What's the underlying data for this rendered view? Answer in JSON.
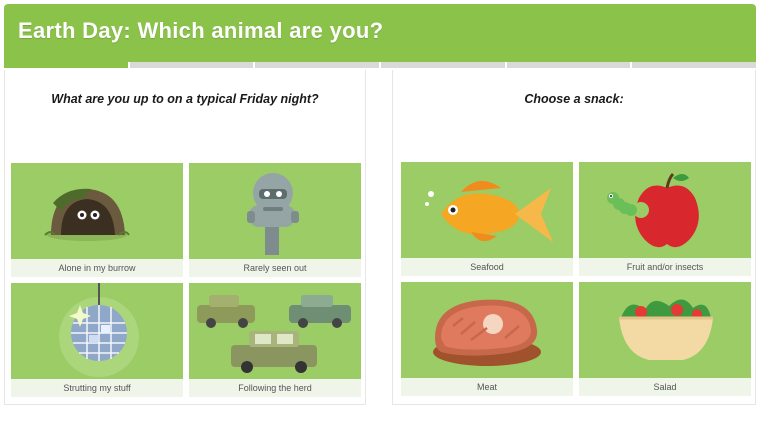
{
  "header": {
    "title": "Earth Day: Which animal are you?"
  },
  "progress": {
    "segments": 6,
    "completed": 1,
    "color_active": "#8bc34a",
    "color_inactive": "#d9d9d9"
  },
  "questions": [
    {
      "text": "What are you up to on a typical Friday night?",
      "answers": [
        {
          "label": "Alone in my burrow",
          "icon": "burrow-icon"
        },
        {
          "label": "Rarely seen out",
          "icon": "binoculars-viewer-icon"
        },
        {
          "label": "Strutting my stuff",
          "icon": "disco-ball-icon"
        },
        {
          "label": "Following the herd",
          "icon": "cars-icon"
        }
      ]
    },
    {
      "text": "Choose a snack:",
      "answers": [
        {
          "label": "Seafood",
          "icon": "goldfish-icon"
        },
        {
          "label": "Fruit and/or insects",
          "icon": "apple-worm-icon"
        },
        {
          "label": "Meat",
          "icon": "steak-icon"
        },
        {
          "label": "Salad",
          "icon": "salad-bowl-icon"
        }
      ]
    }
  ],
  "colors": {
    "brand": "#8bc34a",
    "card_bg": "#9ccc65",
    "caption_bg": "#f0f5ea"
  }
}
